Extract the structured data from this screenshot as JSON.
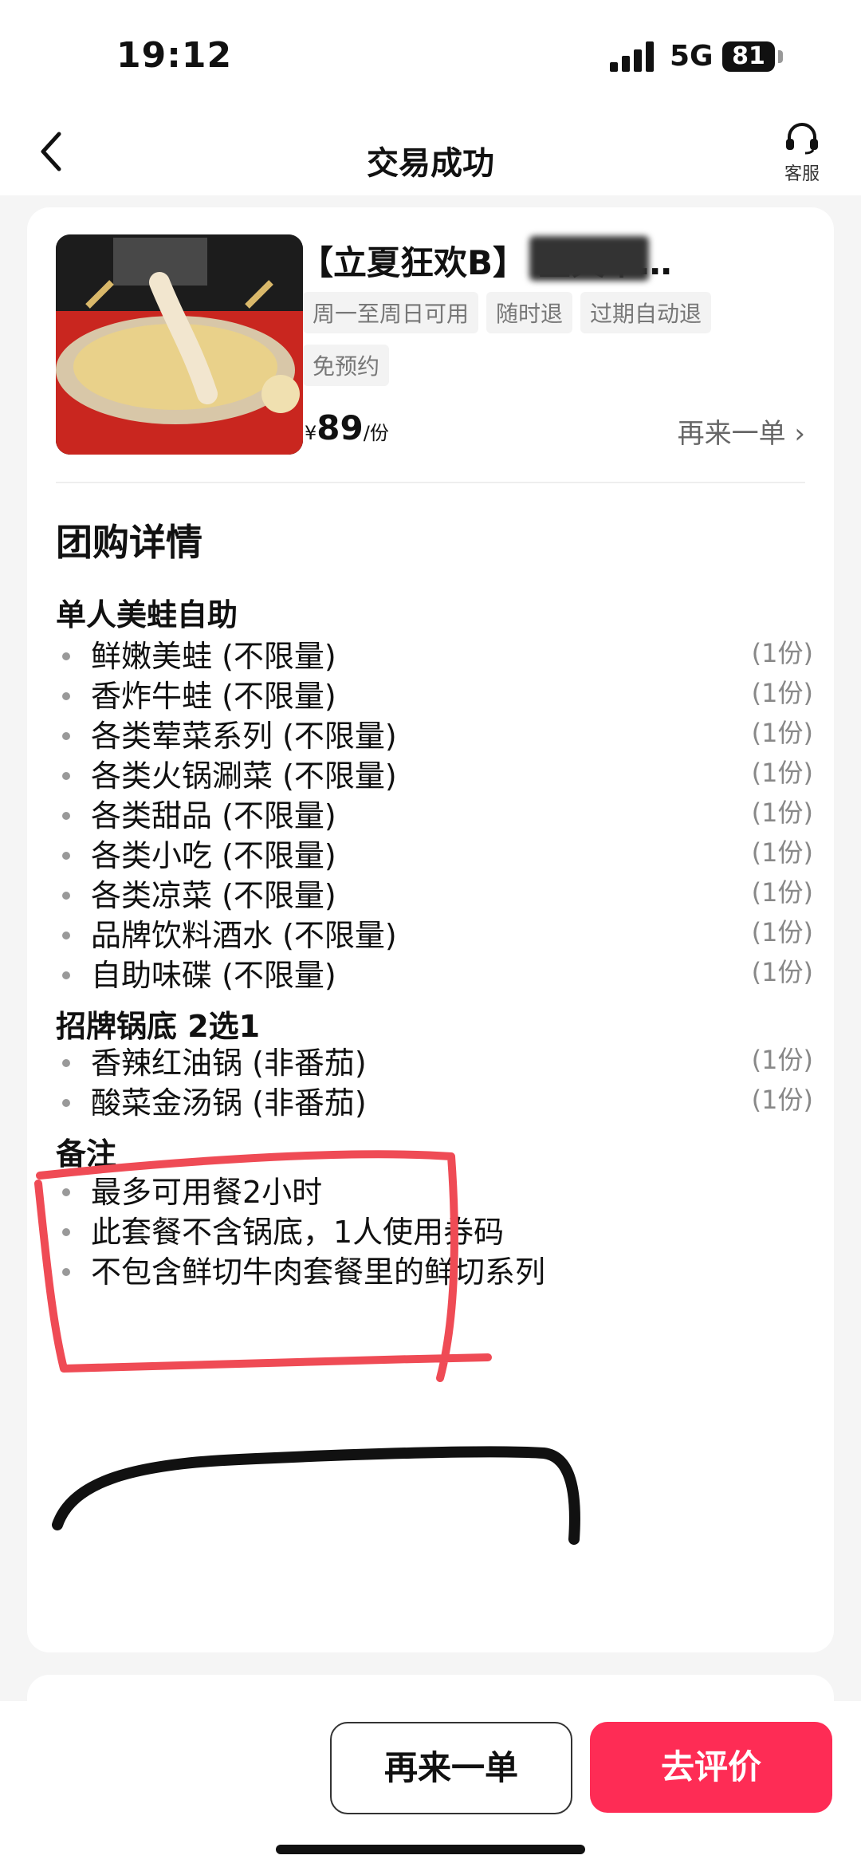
{
  "status_bar": {
    "time": "19:12",
    "network": "5G",
    "battery": "81"
  },
  "nav": {
    "title": "交易成功",
    "customer_service": "客服"
  },
  "product": {
    "name": "【立夏狂欢B】 全天单…",
    "tags": [
      "周一至周日可用",
      "随时退",
      "过期自动退",
      "免预约"
    ],
    "currency": "¥",
    "price": "89",
    "unit": "/份",
    "reorder_link": "再来一单"
  },
  "details": {
    "section_title": "团购详情",
    "groups": [
      {
        "title": "单人美蛙自助",
        "items": [
          {
            "name": "鲜嫩美蛙 (不限量)",
            "qty": "(1份)"
          },
          {
            "name": "香炸牛蛙 (不限量)",
            "qty": "(1份)"
          },
          {
            "name": "各类荤菜系列 (不限量)",
            "qty": "(1份)"
          },
          {
            "name": "各类火锅涮菜 (不限量)",
            "qty": "(1份)"
          },
          {
            "name": "各类甜品 (不限量)",
            "qty": "(1份)"
          },
          {
            "name": "各类小吃 (不限量)",
            "qty": "(1份)"
          },
          {
            "name": "各类凉菜 (不限量)",
            "qty": "(1份)"
          },
          {
            "name": "品牌饮料酒水 (不限量)",
            "qty": "(1份)"
          },
          {
            "name": "自助味碟 (不限量)",
            "qty": "(1份)"
          }
        ]
      },
      {
        "title": "招牌锅底 2选1",
        "items": [
          {
            "name": "香辣红油锅 (非番茄)",
            "qty": "(1份)"
          },
          {
            "name": "酸菜金汤锅 (非番茄)",
            "qty": "(1份)"
          }
        ]
      }
    ],
    "notes": {
      "title": "备注",
      "items": [
        "最多可用餐2小时",
        "此套餐不含锅底，1人使用券码",
        "不包含鲜切牛肉套餐里的鲜切系列"
      ]
    }
  },
  "actions": {
    "reorder": "再来一单",
    "review": "去评价"
  },
  "colors": {
    "accent": "#fe2c55",
    "annotation_red": "#ef4b55",
    "annotation_black": "#111111"
  }
}
